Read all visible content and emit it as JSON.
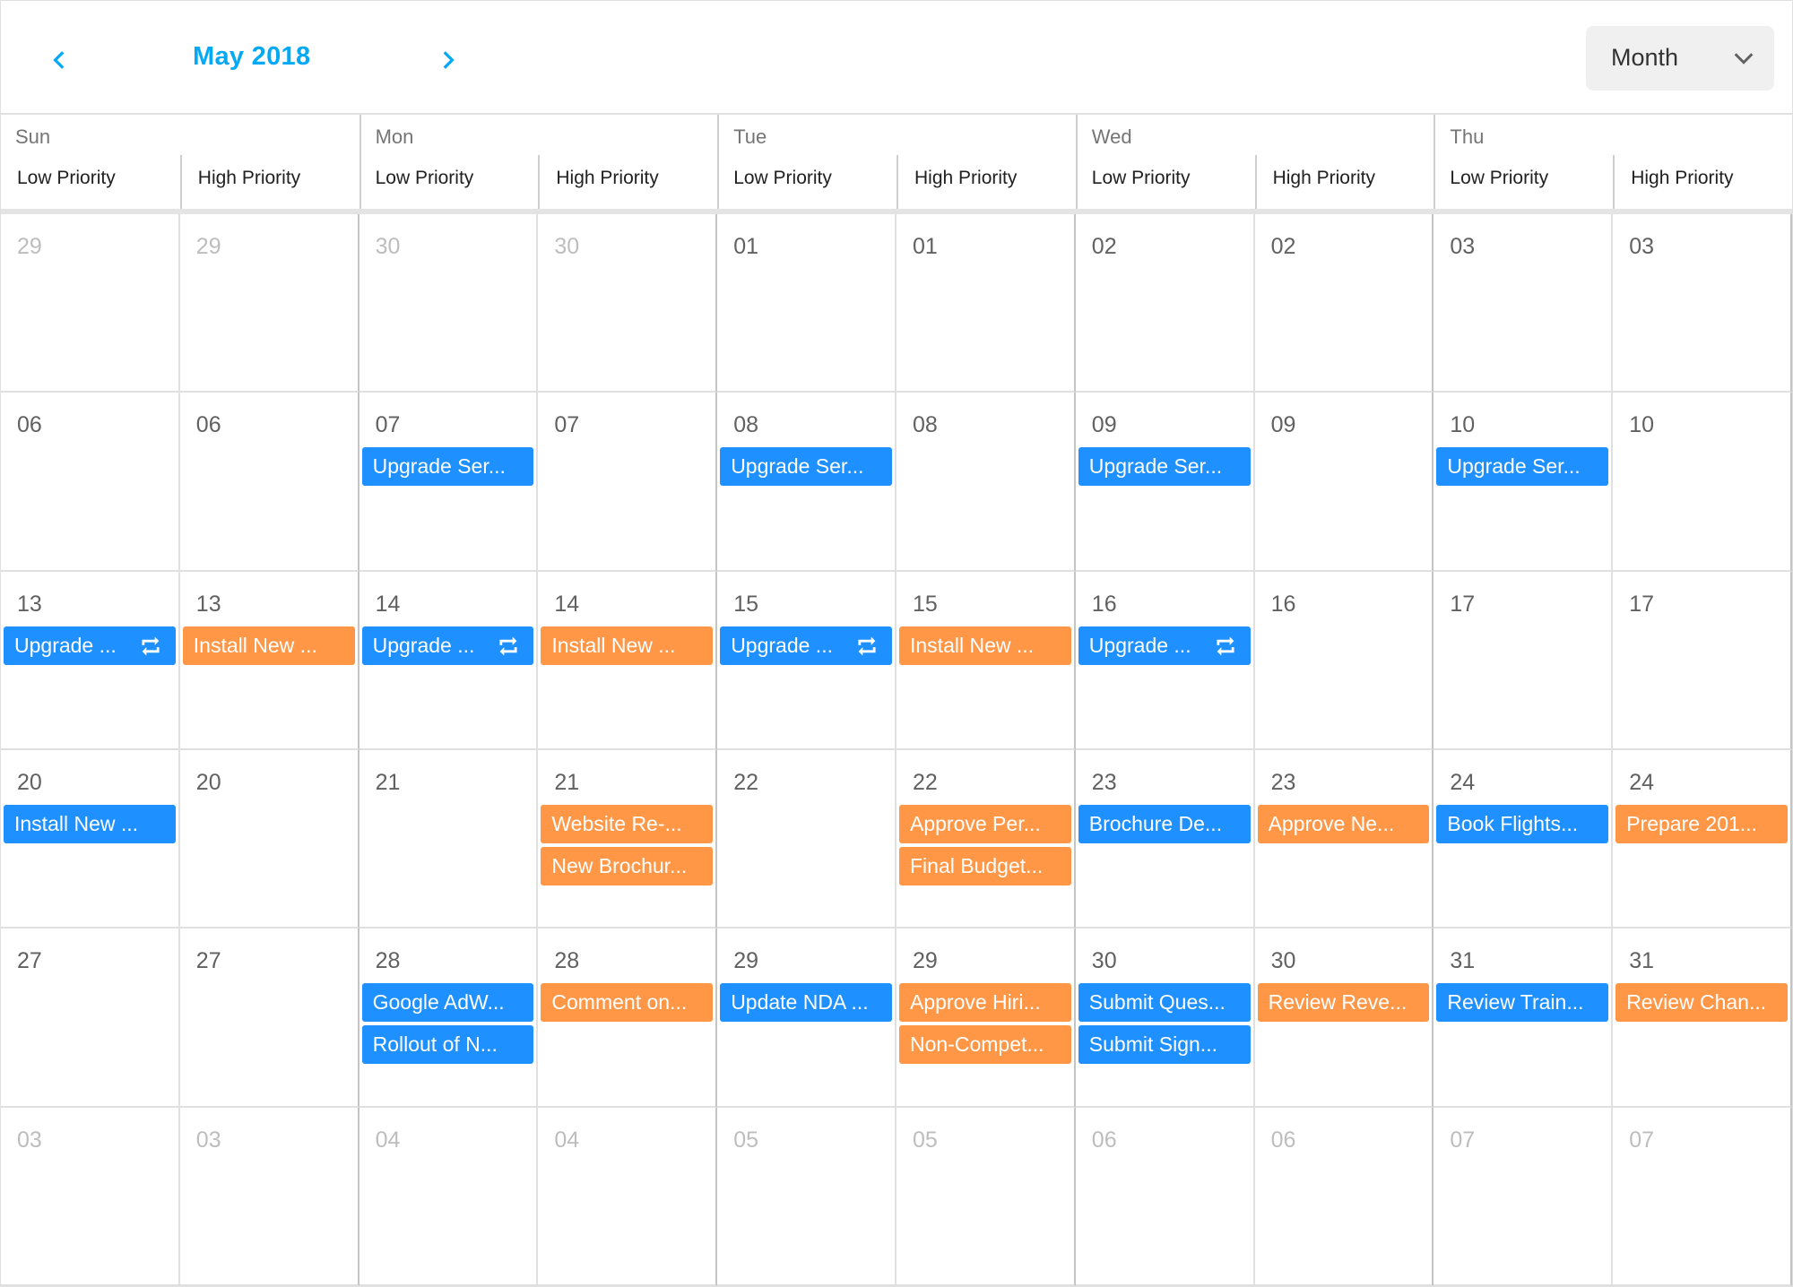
{
  "toolbar": {
    "date_range": "May 2018",
    "prev_icon": "chevron-left-icon",
    "next_icon": "chevron-right-icon",
    "view": "Month",
    "view_icon": "chevron-down-icon"
  },
  "colors": {
    "accent": "#03a9f4",
    "low_priority": "#1e90ff",
    "high_priority": "#ff9747"
  },
  "days": [
    "Sun",
    "Mon",
    "Tue",
    "Wed",
    "Thu"
  ],
  "resources": [
    "Low Priority",
    "High Priority"
  ],
  "weeks": [
    {
      "dates": [
        {
          "d": "29",
          "other": true
        },
        {
          "d": "30",
          "other": true
        },
        {
          "d": "01"
        },
        {
          "d": "02"
        },
        {
          "d": "03"
        }
      ]
    },
    {
      "dates": [
        {
          "d": "06"
        },
        {
          "d": "07"
        },
        {
          "d": "08"
        },
        {
          "d": "09"
        },
        {
          "d": "10"
        }
      ]
    },
    {
      "dates": [
        {
          "d": "13"
        },
        {
          "d": "14"
        },
        {
          "d": "15"
        },
        {
          "d": "16"
        },
        {
          "d": "17"
        }
      ]
    },
    {
      "dates": [
        {
          "d": "20"
        },
        {
          "d": "21"
        },
        {
          "d": "22"
        },
        {
          "d": "23"
        },
        {
          "d": "24"
        }
      ]
    },
    {
      "dates": [
        {
          "d": "27"
        },
        {
          "d": "28"
        },
        {
          "d": "29"
        },
        {
          "d": "30"
        },
        {
          "d": "31"
        }
      ]
    },
    {
      "dates": [
        {
          "d": "03",
          "other": true
        },
        {
          "d": "04",
          "other": true
        },
        {
          "d": "05",
          "other": true
        },
        {
          "d": "06",
          "other": true
        },
        {
          "d": "07",
          "other": true
        }
      ]
    }
  ],
  "events": [
    {
      "week": 1,
      "day": 1,
      "res": 0,
      "title": "Upgrade Ser..."
    },
    {
      "week": 1,
      "day": 2,
      "res": 0,
      "title": "Upgrade Ser..."
    },
    {
      "week": 1,
      "day": 3,
      "res": 0,
      "title": "Upgrade Ser..."
    },
    {
      "week": 1,
      "day": 4,
      "res": 0,
      "title": "Upgrade Ser..."
    },
    {
      "week": 2,
      "day": 0,
      "res": 0,
      "title": "Upgrade ...",
      "recurring": true
    },
    {
      "week": 2,
      "day": 0,
      "res": 1,
      "title": "Install New ..."
    },
    {
      "week": 2,
      "day": 1,
      "res": 0,
      "title": "Upgrade ...",
      "recurring": true
    },
    {
      "week": 2,
      "day": 1,
      "res": 1,
      "title": "Install New ..."
    },
    {
      "week": 2,
      "day": 2,
      "res": 0,
      "title": "Upgrade ...",
      "recurring": true
    },
    {
      "week": 2,
      "day": 2,
      "res": 1,
      "title": "Install New ..."
    },
    {
      "week": 2,
      "day": 3,
      "res": 0,
      "title": "Upgrade ...",
      "recurring": true
    },
    {
      "week": 3,
      "day": 0,
      "res": 0,
      "title": "Install New ..."
    },
    {
      "week": 3,
      "day": 1,
      "res": 1,
      "title": "Website Re-..."
    },
    {
      "week": 3,
      "day": 1,
      "res": 1,
      "title": "New Brochur..."
    },
    {
      "week": 3,
      "day": 2,
      "res": 1,
      "title": "Approve Per..."
    },
    {
      "week": 3,
      "day": 2,
      "res": 1,
      "title": "Final Budget..."
    },
    {
      "week": 3,
      "day": 3,
      "res": 0,
      "title": "Brochure De..."
    },
    {
      "week": 3,
      "day": 3,
      "res": 1,
      "title": "Approve Ne..."
    },
    {
      "week": 3,
      "day": 4,
      "res": 0,
      "title": "Book Flights..."
    },
    {
      "week": 3,
      "day": 4,
      "res": 1,
      "title": "Prepare 201..."
    },
    {
      "week": 4,
      "day": 1,
      "res": 0,
      "title": "Google AdW..."
    },
    {
      "week": 4,
      "day": 1,
      "res": 0,
      "title": "Rollout of N..."
    },
    {
      "week": 4,
      "day": 1,
      "res": 1,
      "title": "Comment on..."
    },
    {
      "week": 4,
      "day": 2,
      "res": 0,
      "title": "Update NDA ..."
    },
    {
      "week": 4,
      "day": 2,
      "res": 1,
      "title": "Approve Hiri..."
    },
    {
      "week": 4,
      "day": 2,
      "res": 1,
      "title": "Non-Compet..."
    },
    {
      "week": 4,
      "day": 3,
      "res": 0,
      "title": "Submit Ques..."
    },
    {
      "week": 4,
      "day": 3,
      "res": 0,
      "title": "Submit Sign..."
    },
    {
      "week": 4,
      "day": 3,
      "res": 1,
      "title": "Review Reve..."
    },
    {
      "week": 4,
      "day": 4,
      "res": 0,
      "title": "Review Train..."
    },
    {
      "week": 4,
      "day": 4,
      "res": 1,
      "title": "Review Chan..."
    }
  ]
}
